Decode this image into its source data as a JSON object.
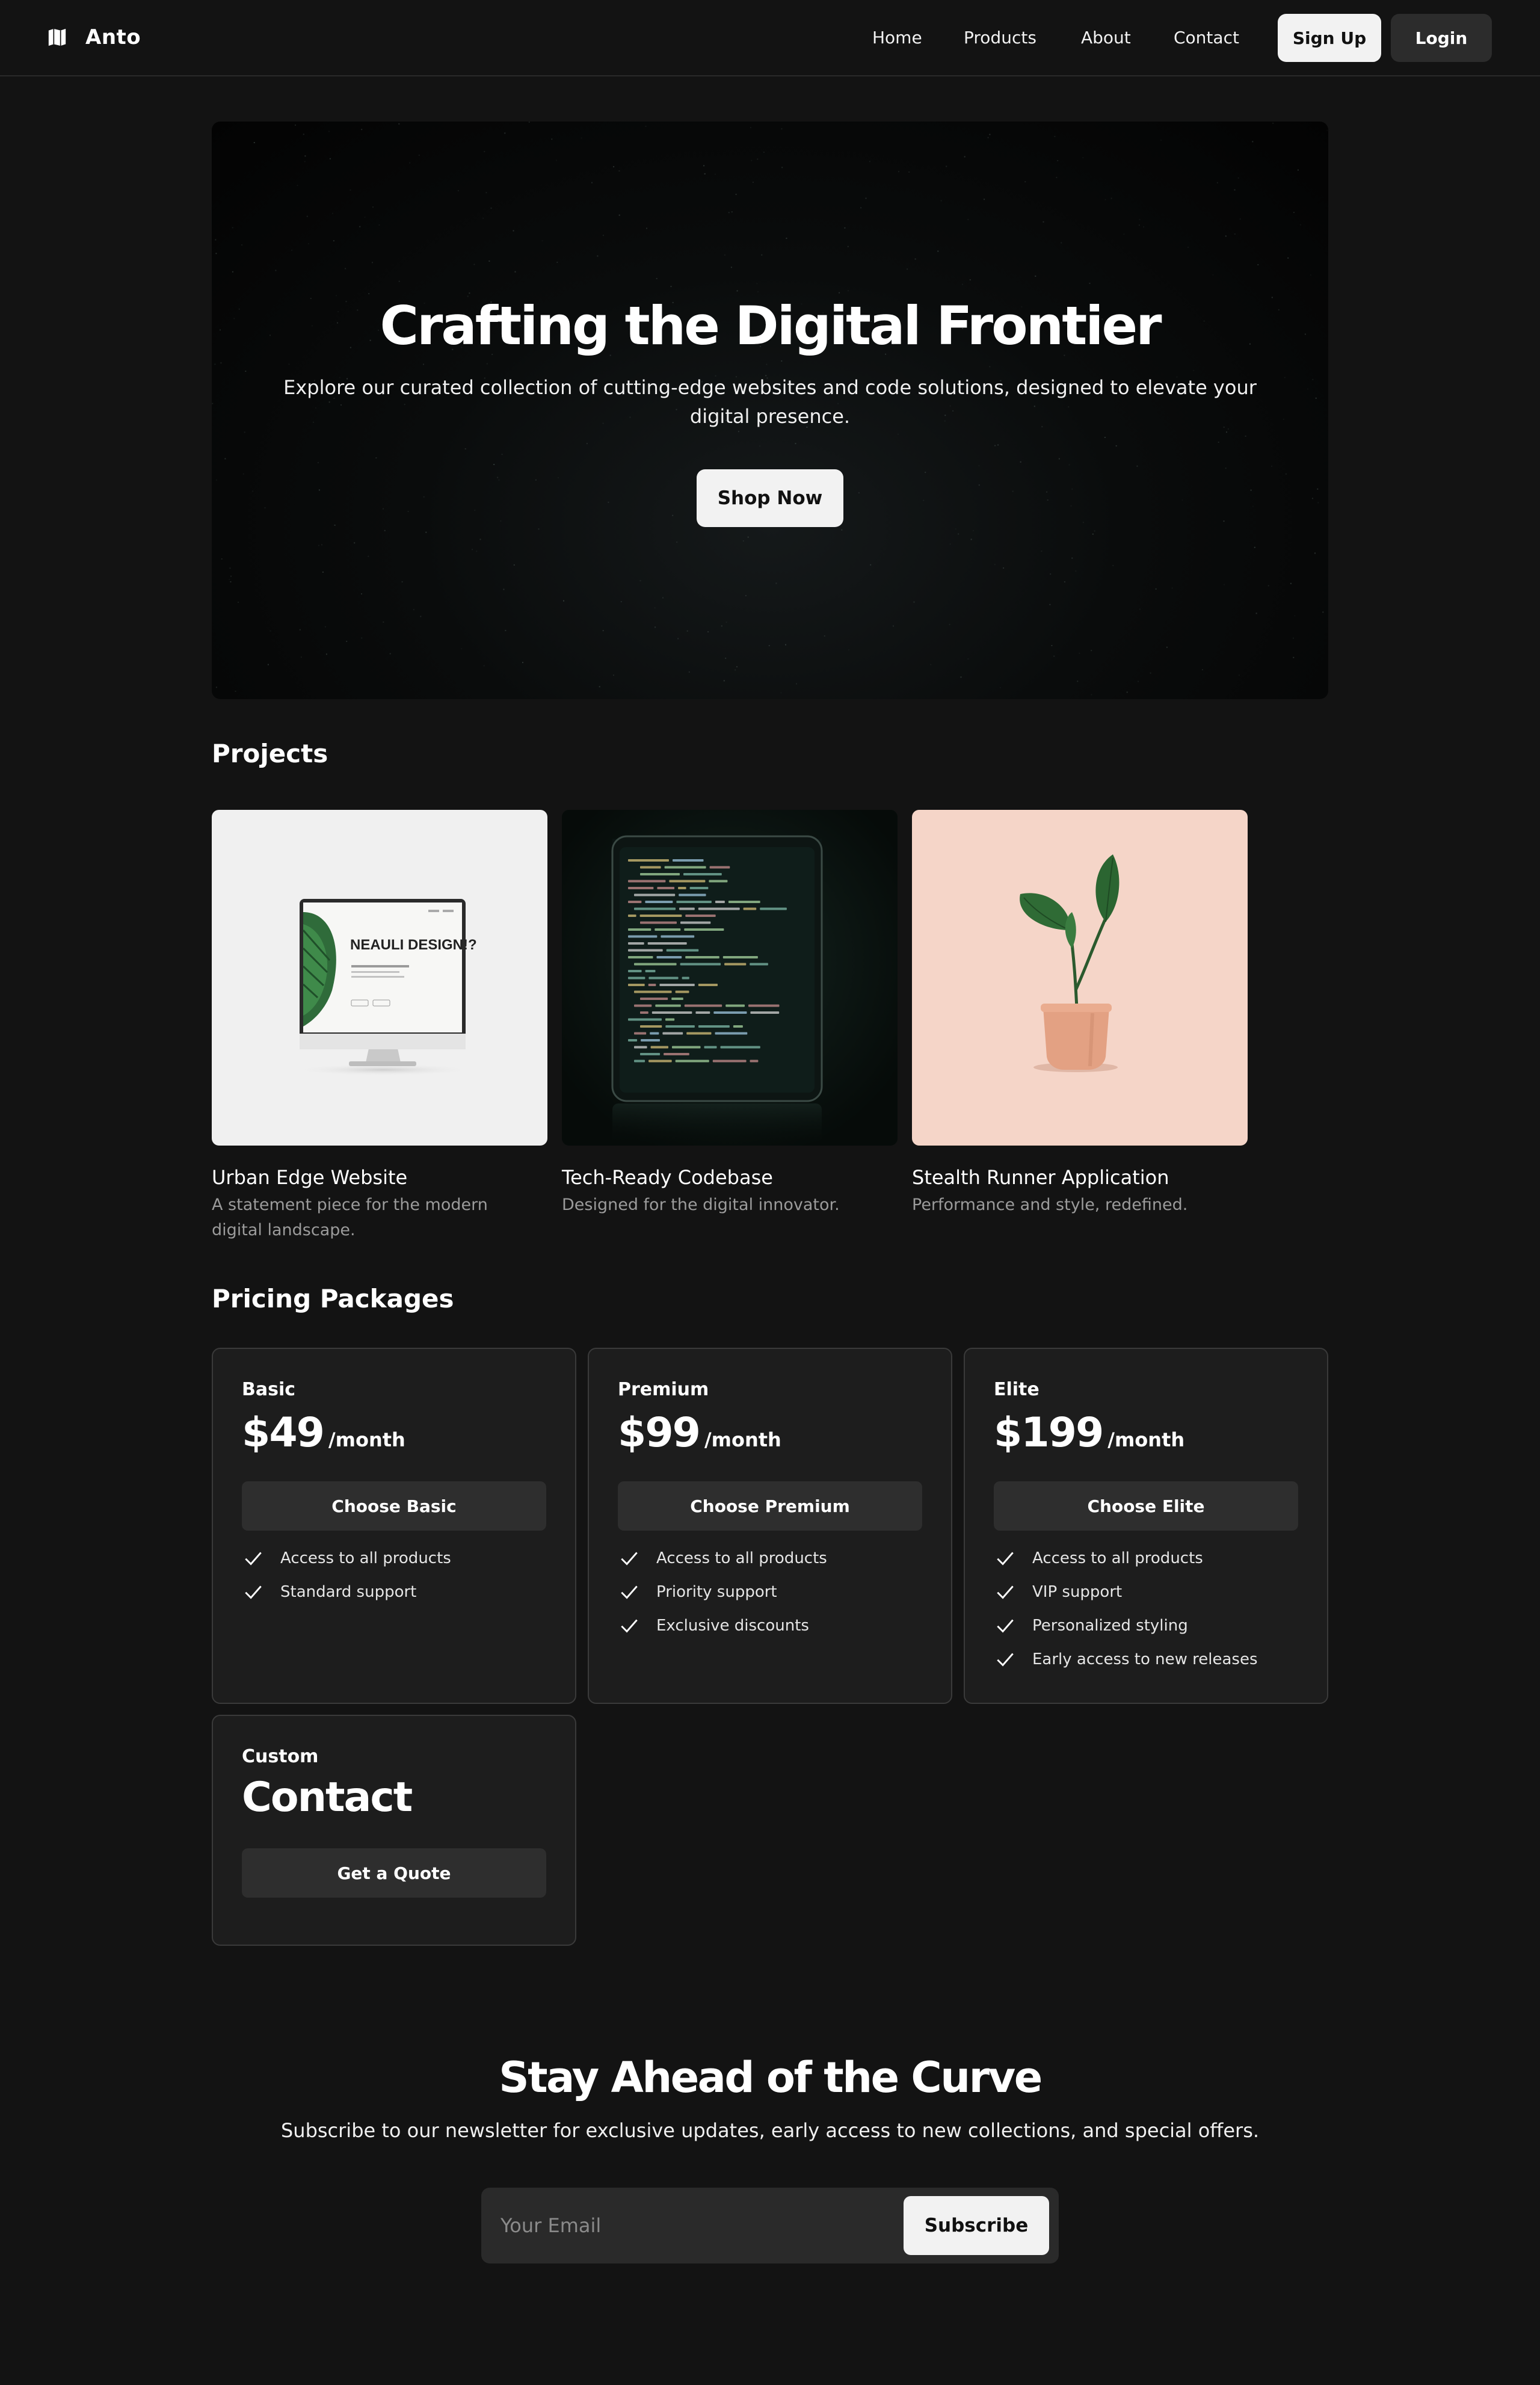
{
  "header": {
    "brand": "Anto",
    "nav": [
      "Home",
      "Products",
      "About",
      "Contact"
    ],
    "signup_label": "Sign Up",
    "login_label": "Login"
  },
  "hero": {
    "title": "Crafting the Digital Frontier",
    "subtitle": "Explore our curated collection of cutting-edge websites and code solutions, designed to elevate your digital presence.",
    "cta_label": "Shop Now"
  },
  "projects": {
    "title": "Projects",
    "items": [
      {
        "name": "Urban Edge Website",
        "description": "A statement piece for the modern digital landscape.",
        "image": "monitor-mockup",
        "screen_text": "NEAULI DESIGN!?"
      },
      {
        "name": "Tech-Ready Codebase",
        "description": "Designed for the digital innovator.",
        "image": "phone-code-mockup"
      },
      {
        "name": "Stealth Runner Application",
        "description": "Performance and style, redefined.",
        "image": "potted-plant"
      }
    ]
  },
  "pricing": {
    "title": "Pricing Packages",
    "plans": [
      {
        "tier": "Basic",
        "price": "$49",
        "unit": "/month",
        "button": "Choose Basic",
        "features": [
          "Access to all products",
          "Standard support"
        ]
      },
      {
        "tier": "Premium",
        "price": "$99",
        "unit": "/month",
        "button": "Choose Premium",
        "features": [
          "Access to all products",
          "Priority support",
          "Exclusive discounts"
        ]
      },
      {
        "tier": "Elite",
        "price": "$199",
        "unit": "/month",
        "button": "Choose Elite",
        "features": [
          "Access to all products",
          "VIP support",
          "Personalized styling",
          "Early access to new releases"
        ]
      }
    ],
    "custom": {
      "tier": "Custom",
      "headline": "Contact",
      "button": "Get a Quote"
    }
  },
  "newsletter": {
    "title": "Stay Ahead of the Curve",
    "subtitle": "Subscribe to our newsletter for exclusive updates, early access to new collections, and special offers.",
    "email_placeholder": "Your Email",
    "button": "Subscribe"
  },
  "colors": {
    "background": "#131313",
    "card": "#1d1d1d",
    "card_border": "#3a3a3a",
    "button_light": "#f2f2f2",
    "button_dark": "#2e2e2e",
    "muted_text": "#9b9b9b",
    "plant_bg": "#f5d5c8"
  }
}
